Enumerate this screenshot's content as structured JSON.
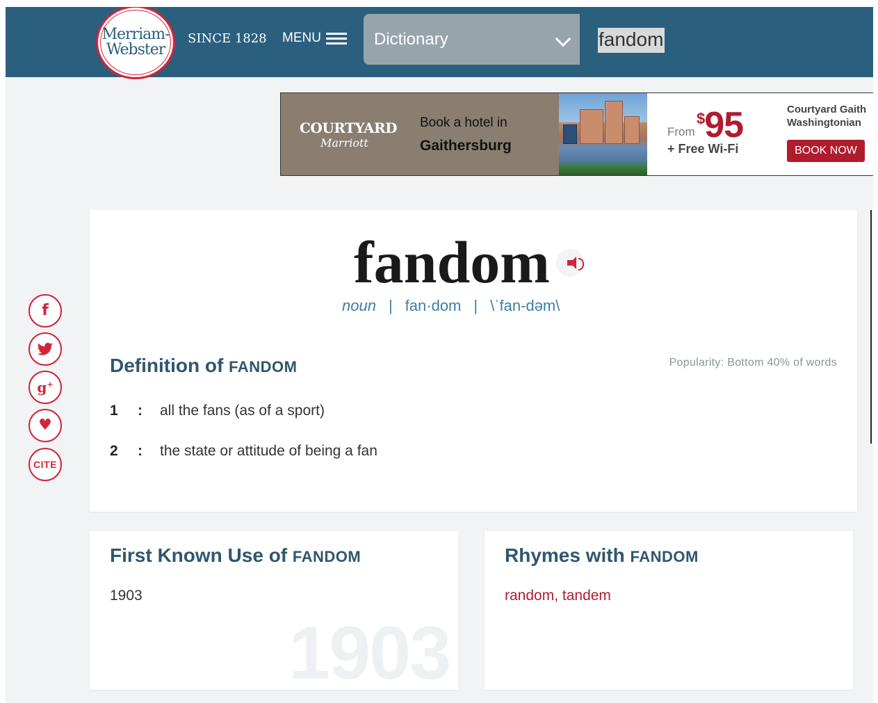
{
  "header": {
    "logo_line1": "Merriam-",
    "logo_line2": "Webster",
    "since": "SINCE 1828",
    "menu_label": "MENU",
    "dictionary_select": "Dictionary",
    "search_value": "fandom"
  },
  "ad": {
    "brand": "COURTYARD",
    "brand_sub": "Marriott",
    "book_text": "Book a hotel in",
    "city": "Gaithersburg",
    "from_label": "From",
    "price_currency": "$",
    "price_amount": "95",
    "wifi": "+ Free Wi-Fi",
    "hotel_name_line1": "Courtyard Gaith",
    "hotel_name_line2": "Washingtonian",
    "cta": "BOOK NOW"
  },
  "social": {
    "cite_label": "CITE"
  },
  "entry": {
    "headword": "fandom",
    "part_of_speech": "noun",
    "separator": "|",
    "syllables": "fan·dom",
    "pronunciation": "\\ˈfan-dəm\\",
    "definition_title": "Definition of",
    "definition_word": "FANDOM",
    "popularity": "Popularity: Bottom 40% of words",
    "senses": [
      {
        "num": "1",
        "colon": ":",
        "text": "all the fans (as of a sport)"
      },
      {
        "num": "2",
        "colon": ":",
        "text": "the state or attitude of being a fan"
      }
    ]
  },
  "first_known_use": {
    "title": "First Known Use of",
    "word": "FANDOM",
    "year": "1903",
    "watermark": "1903"
  },
  "rhymes": {
    "title": "Rhymes with",
    "word": "FANDOM",
    "items": [
      "random",
      "tandem"
    ],
    "separator": ", "
  },
  "colors": {
    "header_bg": "#2b5f7e",
    "brand_red": "#d0253a",
    "link_blue": "#3b7fa7",
    "heading_blue": "#30566f"
  }
}
